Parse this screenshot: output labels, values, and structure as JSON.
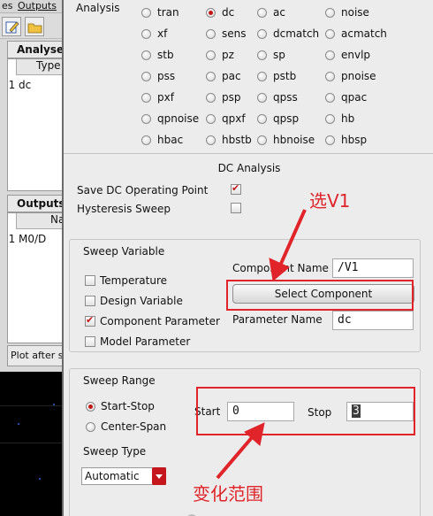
{
  "bg_window": {
    "menu": [
      "es",
      "Outputs"
    ],
    "analyses_title": "Analyses",
    "analyses_header": "Type",
    "analyses_rows": [
      {
        "num": "1",
        "type": "dc"
      }
    ],
    "outputs_title": "Outputs",
    "outputs_header": "Nam",
    "outputs_rows": [
      {
        "num": "1",
        "name": "M0/D"
      }
    ],
    "plot_after": "Plot after s"
  },
  "analysis": {
    "label": "Analysis",
    "selected": "dc",
    "options": [
      "tran",
      "dc",
      "ac",
      "noise",
      "xf",
      "sens",
      "dcmatch",
      "acmatch",
      "stb",
      "pz",
      "sp",
      "envlp",
      "pss",
      "pac",
      "pstb",
      "pnoise",
      "pxf",
      "psp",
      "qpss",
      "qpac",
      "qpnoise",
      "qpxf",
      "qpsp",
      "hb",
      "hbac",
      "hbstb",
      "hbnoise",
      "hbsp"
    ]
  },
  "dc_analysis": {
    "title": "DC Analysis",
    "save_dc_label": "Save DC Operating Point",
    "save_dc_checked": true,
    "hysteresis_label": "Hysteresis Sweep",
    "hysteresis_checked": false
  },
  "sweep_variable": {
    "title": "Sweep Variable",
    "options": [
      {
        "label": "Temperature",
        "checked": false
      },
      {
        "label": "Design Variable",
        "checked": false
      },
      {
        "label": "Component Parameter",
        "checked": true
      },
      {
        "label": "Model Parameter",
        "checked": false
      }
    ],
    "component_name_label": "Component Name",
    "component_name_value": "/V1",
    "select_component_label": "Select Component",
    "parameter_name_label": "Parameter Name",
    "parameter_name_value": "dc"
  },
  "sweep_range": {
    "title": "Sweep Range",
    "options": [
      {
        "label": "Start-Stop",
        "selected": true
      },
      {
        "label": "Center-Span",
        "selected": false
      }
    ],
    "start_label": "Start",
    "start_value": "0",
    "stop_label": "Stop",
    "stop_value": "3"
  },
  "sweep_type": {
    "title": "Sweep Type",
    "value": "Automatic"
  },
  "annotations": {
    "select_v1": "选V1",
    "range": "变化范围",
    "color": "#e0242a"
  },
  "colors": {
    "accent": "#c21717",
    "annotation": "#e0242a"
  }
}
